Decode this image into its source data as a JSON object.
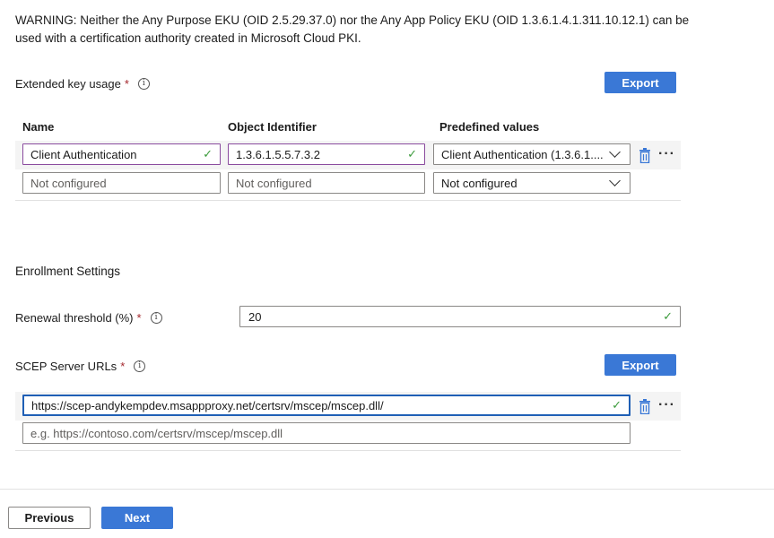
{
  "warning": "WARNING: Neither the Any Purpose EKU (OID 2.5.29.37.0) nor the Any App Policy EKU (OID 1.3.6.1.4.1.311.10.12.1) can be used with a certification authority created in Microsoft Cloud PKI.",
  "eku": {
    "label": "Extended key usage",
    "required_mark": "*",
    "export_label": "Export",
    "columns": {
      "name": "Name",
      "oid": "Object Identifier",
      "predefined": "Predefined values"
    },
    "rows": [
      {
        "name": "Client Authentication",
        "oid": "1.3.6.1.5.5.7.3.2",
        "predefined": "Client Authentication (1.3.6.1...."
      },
      {
        "name_placeholder": "Not configured",
        "oid_placeholder": "Not configured",
        "predefined": "Not configured"
      }
    ]
  },
  "enrollment": {
    "title": "Enrollment Settings",
    "renewal_label": "Renewal threshold (%)",
    "renewal_required": "*",
    "renewal_value": "20"
  },
  "scep": {
    "label": "SCEP Server URLs",
    "required_mark": "*",
    "export_label": "Export",
    "urls": [
      {
        "value": "https://scep-andykempdev.msappproxy.net/certsrv/mscep/mscep.dll/"
      },
      {
        "placeholder": "e.g. https://contoso.com/certsrv/mscep/mscep.dll"
      }
    ]
  },
  "footer": {
    "previous_label": "Previous",
    "next_label": "Next"
  },
  "colors": {
    "primary": "#3a78d6",
    "required": "#a4262c",
    "valid_check": "#3c9b3c",
    "focus_border": "#1f5fb5"
  },
  "icons": [
    "info-icon",
    "checkmark-icon",
    "chevron-down-icon",
    "trash-icon",
    "more-options-icon"
  ]
}
